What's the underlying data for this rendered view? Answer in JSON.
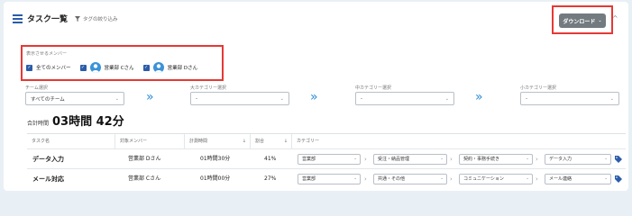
{
  "header": {
    "title": "タスク一覧",
    "filter_link": "タグの絞り込み",
    "download_label": "ダウンロード",
    "icons": {
      "menu": "menu-icon",
      "filter": "filter-icon",
      "collapse": "chevron-up-icon"
    }
  },
  "members": {
    "caption": "表示させるメンバー",
    "items": [
      {
        "label": "全てのメンバー",
        "checked": true,
        "avatar": false
      },
      {
        "label": "営業部 Cさん",
        "checked": true,
        "avatar": true
      },
      {
        "label": "営業部 Dさん",
        "checked": true,
        "avatar": true
      }
    ]
  },
  "filters": {
    "team": {
      "label": "チーム選択",
      "value": "すべてのチーム"
    },
    "major": {
      "label": "大カテゴリー選択",
      "value": "-"
    },
    "middle": {
      "label": "中カテゴリー選択",
      "value": "-"
    },
    "minor": {
      "label": "小カテゴリー選択",
      "value": "-"
    }
  },
  "total": {
    "label": "合計時間",
    "value": "03時間 42分"
  },
  "table": {
    "headers": {
      "task": "タスク名",
      "member": "対象メンバー",
      "time": "計測時間",
      "ratio": "割合",
      "category": "カテゴリー"
    },
    "rows": [
      {
        "task": "データ入力",
        "member": "営業部 Dさん",
        "time": "01時間30分",
        "ratio": "41%",
        "cats": [
          "営業部",
          "受注・納品管理",
          "契約・事務手続き",
          "データ入力"
        ]
      },
      {
        "task": "メール対応",
        "member": "営業部 Cさん",
        "time": "01時間00分",
        "ratio": "27%",
        "cats": [
          "営業部",
          "共通・その他",
          "コミュニケーション",
          "メール連絡"
        ]
      }
    ]
  },
  "colors": {
    "accent": "#2a5caa",
    "highlight": "#e53935",
    "download_bg": "#737b80",
    "chevron": "#2a8ad8"
  }
}
